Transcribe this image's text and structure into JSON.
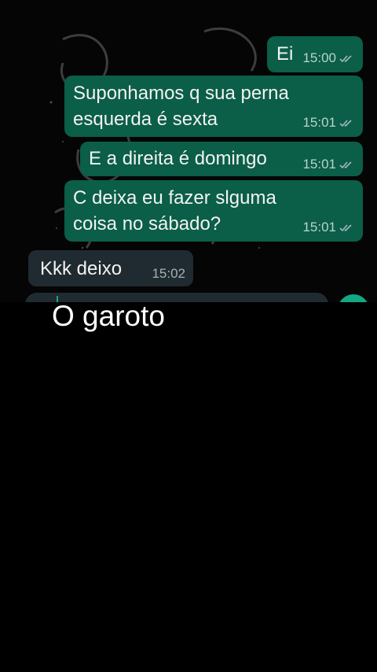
{
  "messages": [
    {
      "text": "Ei",
      "time": "15:00",
      "direction": "outgoing"
    },
    {
      "text": "Suponhamos q sua perna\nesquerda é sexta",
      "time": "15:01",
      "direction": "outgoing"
    },
    {
      "text": "E a direita é domingo",
      "time": "15:01",
      "direction": "outgoing"
    },
    {
      "text": "C deixa eu fazer slguma\ncoisa no sábado?",
      "time": "15:01",
      "direction": "outgoing"
    },
    {
      "text": "Kkk deixo",
      "time": "15:02",
      "direction": "incoming"
    }
  ],
  "caption": "O garoto",
  "colors": {
    "outgoing_bubble": "#0b5e47",
    "incoming_bubble": "#1f2b31",
    "accent": "#12a884",
    "background": "#000000"
  },
  "icons": {
    "read_receipt": "double-check-icon",
    "send": "send-button-icon"
  }
}
